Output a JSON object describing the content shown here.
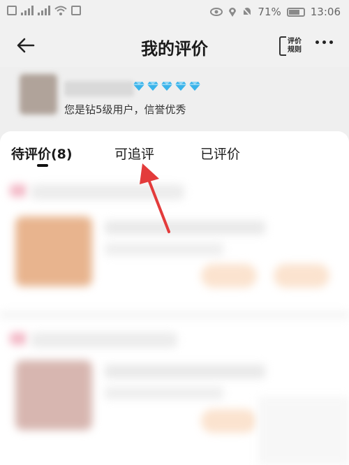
{
  "status_bar": {
    "battery_percent": "71%",
    "time": "13:06"
  },
  "header": {
    "title": "我的评价",
    "rules_label_line1": "评价",
    "rules_label_line2": "规则"
  },
  "profile": {
    "level_text": "您是钻5级用户，信誉优秀",
    "diamond_count": 5,
    "diamond_color": "#3ab3ea"
  },
  "tabs": [
    {
      "label": "待评价(8)",
      "active": true
    },
    {
      "label": "可追评",
      "active": false
    },
    {
      "label": "已评价",
      "active": false
    }
  ],
  "colors": {
    "annotation_arrow": "#e33b3b",
    "page_background": "#efefef",
    "card_background": "#ffffff"
  }
}
